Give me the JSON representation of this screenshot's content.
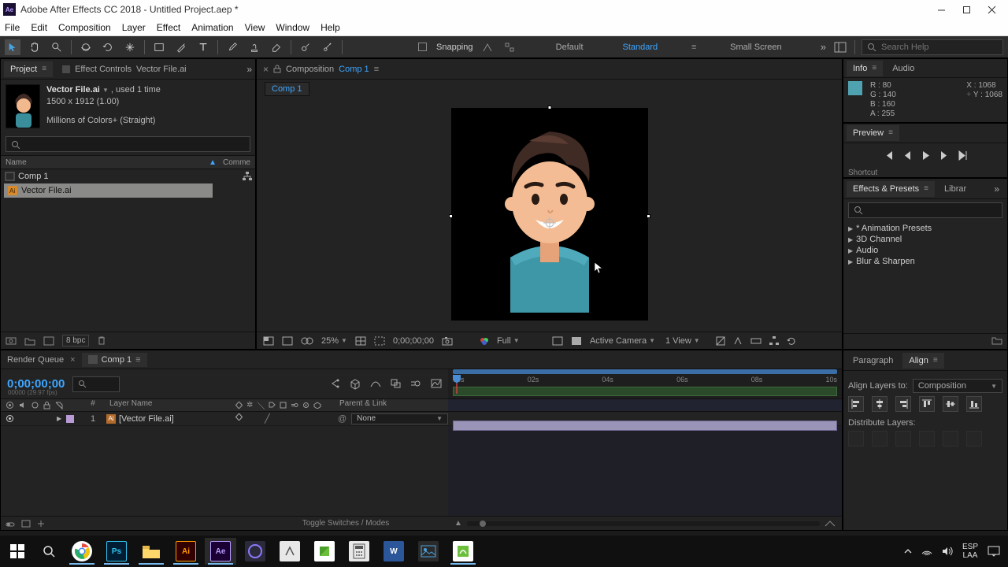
{
  "window": {
    "title": "Adobe After Effects CC 2018 - Untitled Project.aep *"
  },
  "menu": [
    "File",
    "Edit",
    "Composition",
    "Layer",
    "Effect",
    "Animation",
    "View",
    "Window",
    "Help"
  ],
  "toolbar": {
    "snapping_label": "Snapping",
    "workspaces": [
      "Default",
      "Standard",
      "Small Screen"
    ],
    "active_workspace": "Standard",
    "search_placeholder": "Search Help"
  },
  "project_panel": {
    "tab_project": "Project",
    "tab_effect_controls": "Effect Controls",
    "tab_effect_controls_item": "Vector File.ai",
    "asset": {
      "name": "Vector File.ai",
      "usage": ", used 1 time",
      "dims": "1500 x 1912 (1.00)",
      "colors": "Millions of Colors+ (Straight)"
    },
    "columns": {
      "name": "Name",
      "comment": "Comme"
    },
    "rows": [
      {
        "label": "Comp 1",
        "type": "comp",
        "selected": false
      },
      {
        "label": "Vector File.ai",
        "type": "ai",
        "selected": true
      }
    ],
    "bpc": "8 bpc"
  },
  "composition_panel": {
    "tab_label": "Composition",
    "tab_comp_name": "Comp 1",
    "subtab": "Comp 1",
    "footer": {
      "zoom": "25%",
      "timecode": "0;00;00;00",
      "resolution": "Full",
      "camera": "Active Camera",
      "views": "1 View"
    }
  },
  "info_panel": {
    "tab": "Info",
    "tab_audio": "Audio",
    "R": "80",
    "G": "140",
    "B": "160",
    "A": "255",
    "X": "1068",
    "Y": "1068"
  },
  "preview_panel": {
    "tab": "Preview",
    "shortcut": "Shortcut"
  },
  "effects_presets": {
    "tab": "Effects & Presets",
    "tab_library": "Librar",
    "items": [
      "* Animation Presets",
      "3D Channel",
      "Audio",
      "Blur & Sharpen"
    ]
  },
  "timeline": {
    "tab_render_queue": "Render Queue",
    "tab_comp": "Comp 1",
    "timecode": "0;00;00;00",
    "timecode_sub": "00000 (29.97 fps)",
    "ruler": [
      "00s",
      "02s",
      "04s",
      "06s",
      "08s",
      "10s"
    ],
    "columns": {
      "hash": "#",
      "layer_name": "Layer Name",
      "parent_link": "Parent & Link"
    },
    "layer": {
      "number": "1",
      "name": "[Vector File.ai]",
      "parent": "None"
    },
    "footer_center": "Toggle Switches / Modes"
  },
  "align_panel": {
    "tab_paragraph": "Paragraph",
    "tab_align": "Align",
    "align_layers_to_label": "Align Layers to:",
    "align_target": "Composition",
    "distribute_label": "Distribute Layers:"
  },
  "taskbar": {
    "lang1": "ESP",
    "lang2": "LAA"
  }
}
